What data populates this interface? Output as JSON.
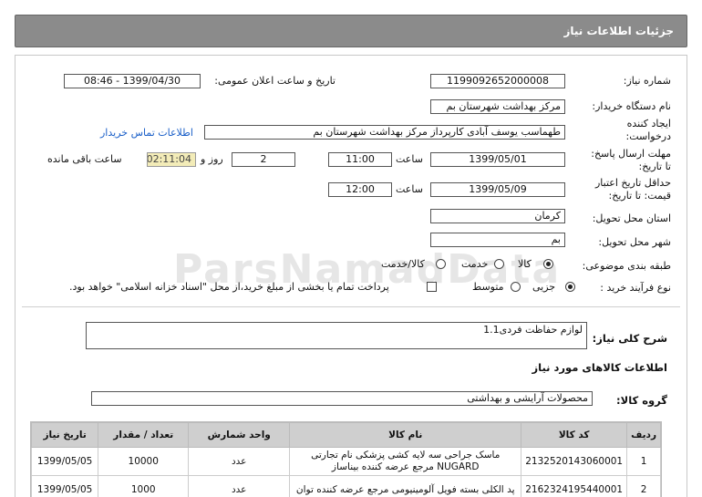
{
  "header": {
    "title": "جزئیات اطلاعات نیاز"
  },
  "form": {
    "need_number_label": "شماره نیاز:",
    "need_number": "1199092652000008",
    "announce_label": "تاریخ و ساعت اعلان عمومی:",
    "announce_value": "1399/04/30 - 08:46",
    "buyer_label": "نام دستگاه خریدار:",
    "buyer": "مرکز بهداشت شهرستان بم",
    "creator_label": "ایجاد کننده درخواست:",
    "creator": "طهماسب یوسف آبادی کارپرداز مرکز بهداشت شهرستان بم",
    "contact_link": "اطلاعات تماس خریدار",
    "deadline_label": "مهلت ارسال پاسخ: تا تاریخ:",
    "deadline_date": "1399/05/01",
    "time_label": "ساعت",
    "deadline_time": "11:00",
    "days_value": "2",
    "days_label": "روز و",
    "remaining_value": "02:11:04",
    "remaining_label": "ساعت باقی مانده",
    "validity_label": "حداقل تاریخ اعتبار قیمت: تا تاریخ:",
    "validity_date": "1399/05/09",
    "validity_time": "12:00",
    "province_label": "استان محل تحویل:",
    "province": "کرمان",
    "city_label": "شهر محل تحویل:",
    "city": "بم",
    "category_label": "طبقه بندی موضوعی:",
    "category_options": [
      "کالا",
      "خدمت",
      "کالا/خدمت"
    ],
    "process_label": "نوع فرآیند خرید :",
    "process_options": [
      "جزیی",
      "متوسط"
    ],
    "payment_note": "پرداخت تمام یا بخشی از مبلغ خرید،از محل \"اسناد خزانه اسلامی\" خواهد بود."
  },
  "summary": {
    "label": "شرح کلی نیاز:",
    "value": "لوازم حفاظت فردی1.1"
  },
  "goods": {
    "section_title": "اطلاعات کالاهای مورد نیاز",
    "group_label": "گروه کالا:",
    "group_value": "محصولات آرایشی و بهداشتی"
  },
  "table": {
    "headers": [
      "ردیف",
      "کد کالا",
      "نام کالا",
      "واحد شمارش",
      "تعداد / مقدار",
      "تاریخ نیاز"
    ],
    "rows": [
      [
        "1",
        "2132520143060001",
        "ماسک جراحی سه لایه کشی پزشکی نام تجارتی NUGARD مرجع عرضه کننده بیناساز",
        "عدد",
        "10000",
        "1399/05/05"
      ],
      [
        "2",
        "2162324195440001",
        "پد الکلی بسته فویل آلومینیومی مرجع عرضه کننده توان",
        "عدد",
        "1000",
        "1399/05/05"
      ]
    ]
  }
}
